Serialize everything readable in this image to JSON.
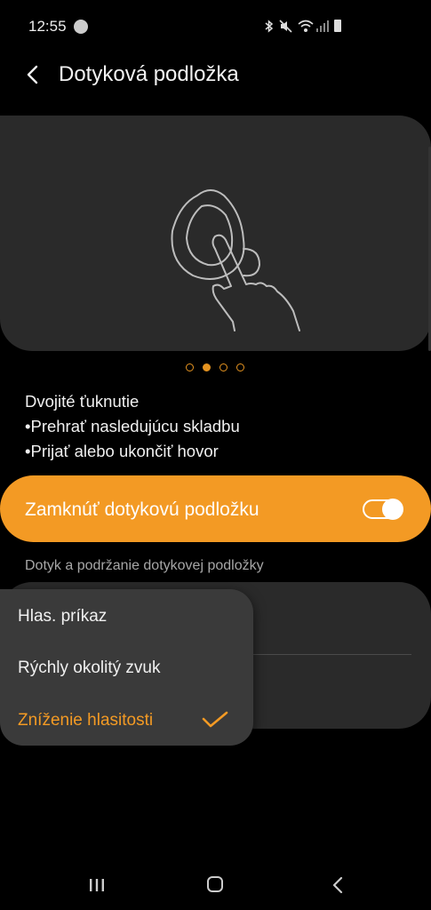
{
  "status_bar": {
    "time": "12:55",
    "icons": [
      "spotify-icon",
      "bluetooth-icon",
      "mute-icon",
      "wifi-icon",
      "signal-icon",
      "battery-icon"
    ]
  },
  "header": {
    "title": "Dotyková podložka"
  },
  "description": {
    "line1": "Dvojité ťuknutie",
    "line2": "•Prehrať nasledujúcu skladbu",
    "line3": "•Prijať alebo ukončiť hovor"
  },
  "pager": {
    "count": 4,
    "active_index": 1
  },
  "lock_touchpad": {
    "label": "Zamknúť dotykovú podložku",
    "enabled": true
  },
  "section": {
    "label": "Dotyk a podržanie dotykovej podložky"
  },
  "menu": {
    "items": [
      {
        "label": "Hlas. príkaz",
        "selected": false
      },
      {
        "label": "Rýchly okolitý zvuk",
        "selected": false
      },
      {
        "label": "Zníženie hlasitosti",
        "selected": true
      }
    ]
  },
  "colors": {
    "accent": "#f39a24",
    "background": "#000000",
    "card": "#2a2a2a",
    "menu": "#3a3a3a"
  }
}
